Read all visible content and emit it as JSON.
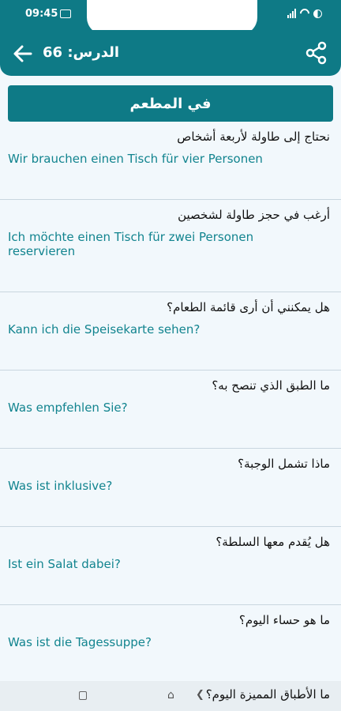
{
  "status_bar": {
    "time": "09:45"
  },
  "app_bar": {
    "lesson_title": "الدرس: 66"
  },
  "topic": {
    "title": "في المطعم"
  },
  "phrases": [
    {
      "ar": "نحتاج إلى طاولة لأربعة أشخاص",
      "de": "Wir brauchen einen Tisch für vier Personen"
    },
    {
      "ar": "أرغب في حجز طاولة لشخصين",
      "de": "Ich möchte einen Tisch für zwei Personen reservieren"
    },
    {
      "ar": "هل يمكنني أن أرى قائمة الطعام؟",
      "de": "Kann ich die Speisekarte sehen?"
    },
    {
      "ar": "ما الطبق الذي تنصح به؟",
      "de": "Was empfehlen Sie?"
    },
    {
      "ar": "ماذا تشمل الوجبة؟",
      "de": "Was ist inklusive?"
    },
    {
      "ar": "هل يُقدم معها السلطة؟",
      "de": "Ist ein Salat dabei?"
    },
    {
      "ar": "ما هو حساء اليوم؟",
      "de": "Was ist die Tagessuppe?"
    },
    {
      "ar": "ما الأطباق المميزة اليوم؟"
    }
  ]
}
